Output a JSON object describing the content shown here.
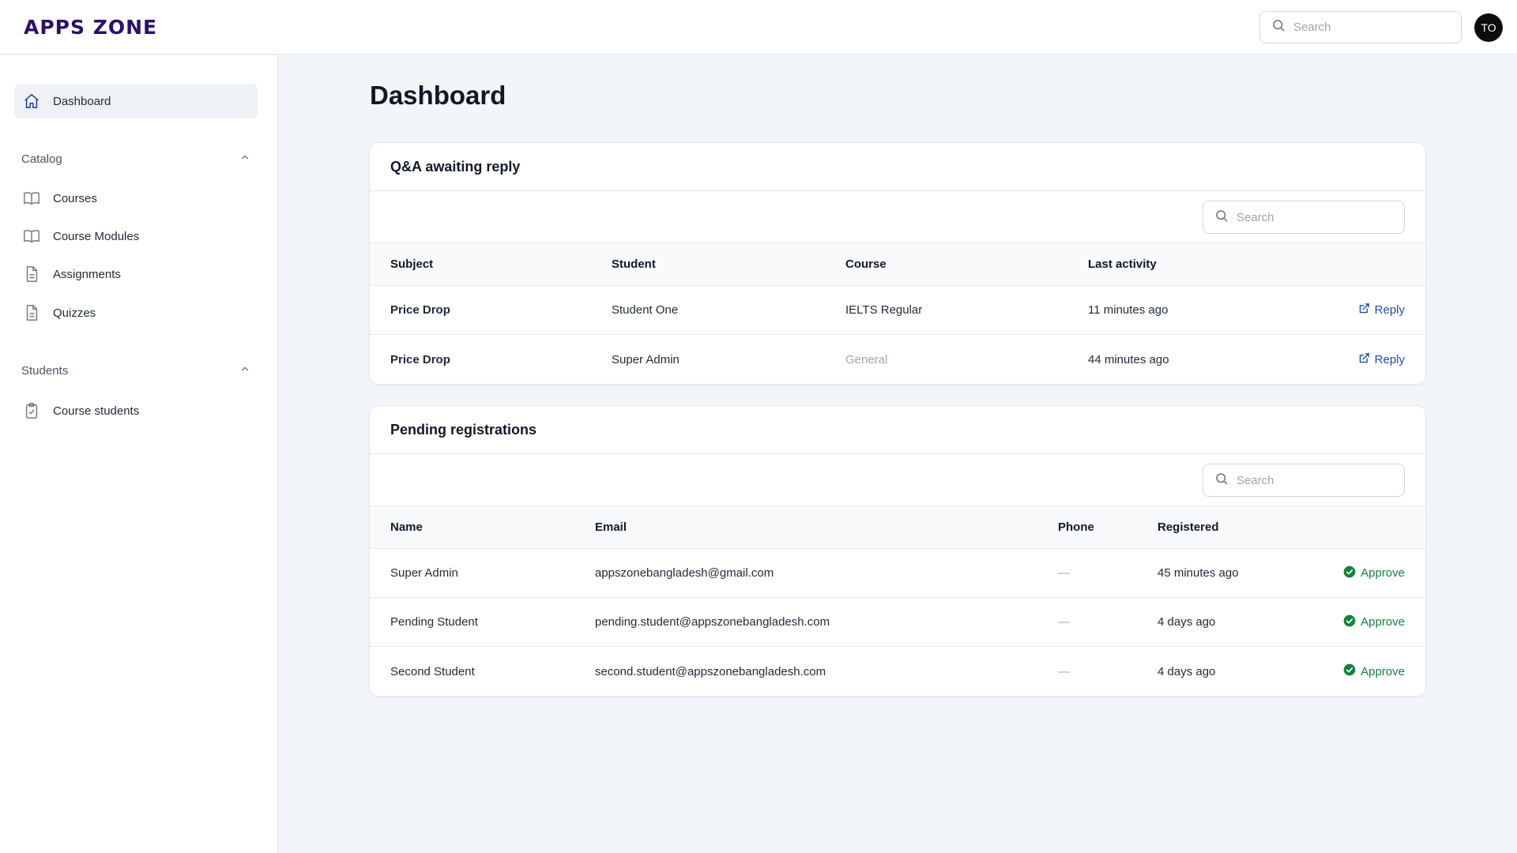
{
  "app": {
    "logo_text": "APPS ZONE",
    "avatar_initials": "TO"
  },
  "header": {
    "search_placeholder": "Search"
  },
  "sidebar": {
    "dashboard": "Dashboard",
    "catalog": {
      "label": "Catalog",
      "items": [
        "Courses",
        "Course Modules",
        "Assignments",
        "Quizzes"
      ]
    },
    "students": {
      "label": "Students",
      "items": [
        "Course students"
      ]
    }
  },
  "page": {
    "title": "Dashboard"
  },
  "qa": {
    "title": "Q&A awaiting reply",
    "search_placeholder": "Search",
    "columns": [
      "Subject",
      "Student",
      "Course",
      "Last activity"
    ],
    "rows": [
      {
        "subject": "Price Drop",
        "student": "Student One",
        "course": "IELTS Regular",
        "course_muted": false,
        "last_activity": "11 minutes ago",
        "action": "Reply"
      },
      {
        "subject": "Price Drop",
        "student": "Super Admin",
        "course": "General",
        "course_muted": true,
        "last_activity": "44 minutes ago",
        "action": "Reply"
      }
    ]
  },
  "registrations": {
    "title": "Pending registrations",
    "search_placeholder": "Search",
    "columns": [
      "Name",
      "Email",
      "Phone",
      "Registered"
    ],
    "rows": [
      {
        "name": "Super Admin",
        "email": "appszonebangladesh@gmail.com",
        "phone": "—",
        "registered": "45 minutes ago",
        "action": "Approve"
      },
      {
        "name": "Pending Student",
        "email": "pending.student@appszonebangladesh.com",
        "phone": "—",
        "registered": "4 days ago",
        "action": "Approve"
      },
      {
        "name": "Second Student",
        "email": "second.student@appszonebangladesh.com",
        "phone": "—",
        "registered": "4 days ago",
        "action": "Approve"
      }
    ]
  },
  "colors": {
    "brand": "#2e1065",
    "link": "#1e4d9b",
    "success": "#15803d",
    "background": "#f2f5f9"
  }
}
